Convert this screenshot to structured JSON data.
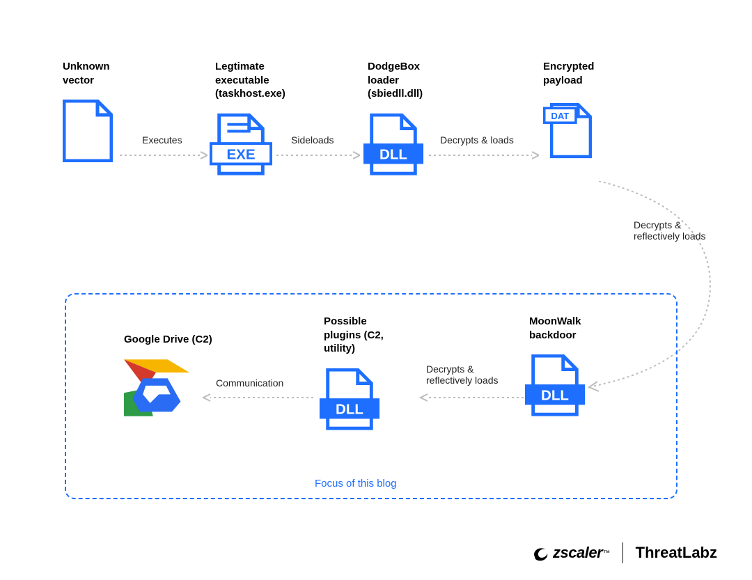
{
  "nodes": {
    "unknown": {
      "label": "Unknown\nvector"
    },
    "exe": {
      "label": "Legtimate\nexecutable\n(taskhost.exe)",
      "badge": "EXE"
    },
    "loader": {
      "label": "DodgeBox\nloader\n(sbiedll.dll)",
      "badge": "DLL"
    },
    "payload": {
      "label": "Encrypted\npayload",
      "badge": "DAT"
    },
    "backdoor": {
      "label": "MoonWalk\nbackdoor",
      "badge": "DLL"
    },
    "plugins": {
      "label": "Possible\nplugins (C2,\nutility)",
      "badge": "DLL"
    },
    "gdrive": {
      "label": "Google Drive (C2)"
    }
  },
  "arrows": {
    "a1": "Executes",
    "a2": "Sideloads",
    "a3": "Decrypts & loads",
    "a4": "Decrypts &\nreflectively loads",
    "a5": "Decrypts &\nreflectively loads",
    "a6": "Communication"
  },
  "focus_caption": "Focus of this blog",
  "footer": {
    "brand1": "zscaler",
    "brand1_tm": "™",
    "brand2": "ThreatLabz"
  },
  "colors": {
    "blue": "#1e6fff",
    "grey": "#bcbcbc"
  }
}
